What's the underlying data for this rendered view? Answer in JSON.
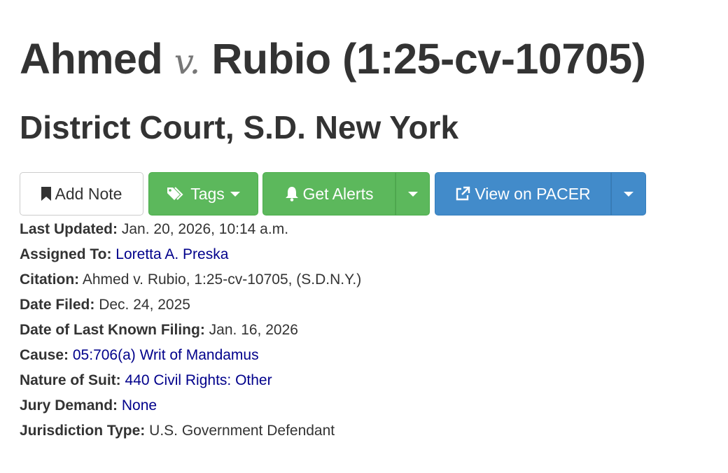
{
  "header": {
    "case_name_left": "Ahmed",
    "case_vs": "v.",
    "case_name_right": "Rubio (1:25-cv-10705)",
    "court": "District Court, S.D. New York"
  },
  "toolbar": {
    "add_note_label": "Add Note",
    "tags_label": "Tags",
    "get_alerts_label": "Get Alerts",
    "view_on_pacer_label": "View on PACER"
  },
  "colors": {
    "success": "#5cb85c",
    "primary": "#428bca",
    "link": "#00008b",
    "text": "#333333"
  },
  "icons": {
    "add_note": "bookmark-icon",
    "tags": "tags-icon",
    "alerts": "bell-icon",
    "pacer": "external-link-icon"
  },
  "details": {
    "last_updated_label": "Last Updated:",
    "last_updated_value": "Jan. 20, 2026, 10:14 a.m.",
    "assigned_to_label": "Assigned To:",
    "assigned_to_value": "Loretta A. Preska",
    "citation_label": "Citation:",
    "citation_value": "Ahmed v. Rubio, 1:25-cv-10705, (S.D.N.Y.)",
    "date_filed_label": "Date Filed:",
    "date_filed_value": "Dec. 24, 2025",
    "last_known_filing_label": "Date of Last Known Filing:",
    "last_known_filing_value": "Jan. 16, 2026",
    "cause_label": "Cause:",
    "cause_value": "05:706(a) Writ of Mandamus",
    "nature_of_suit_label": "Nature of Suit:",
    "nature_of_suit_value": "440 Civil Rights: Other",
    "jury_demand_label": "Jury Demand:",
    "jury_demand_value": "None",
    "jurisdiction_type_label": "Jurisdiction Type:",
    "jurisdiction_type_value": "U.S. Government Defendant"
  }
}
